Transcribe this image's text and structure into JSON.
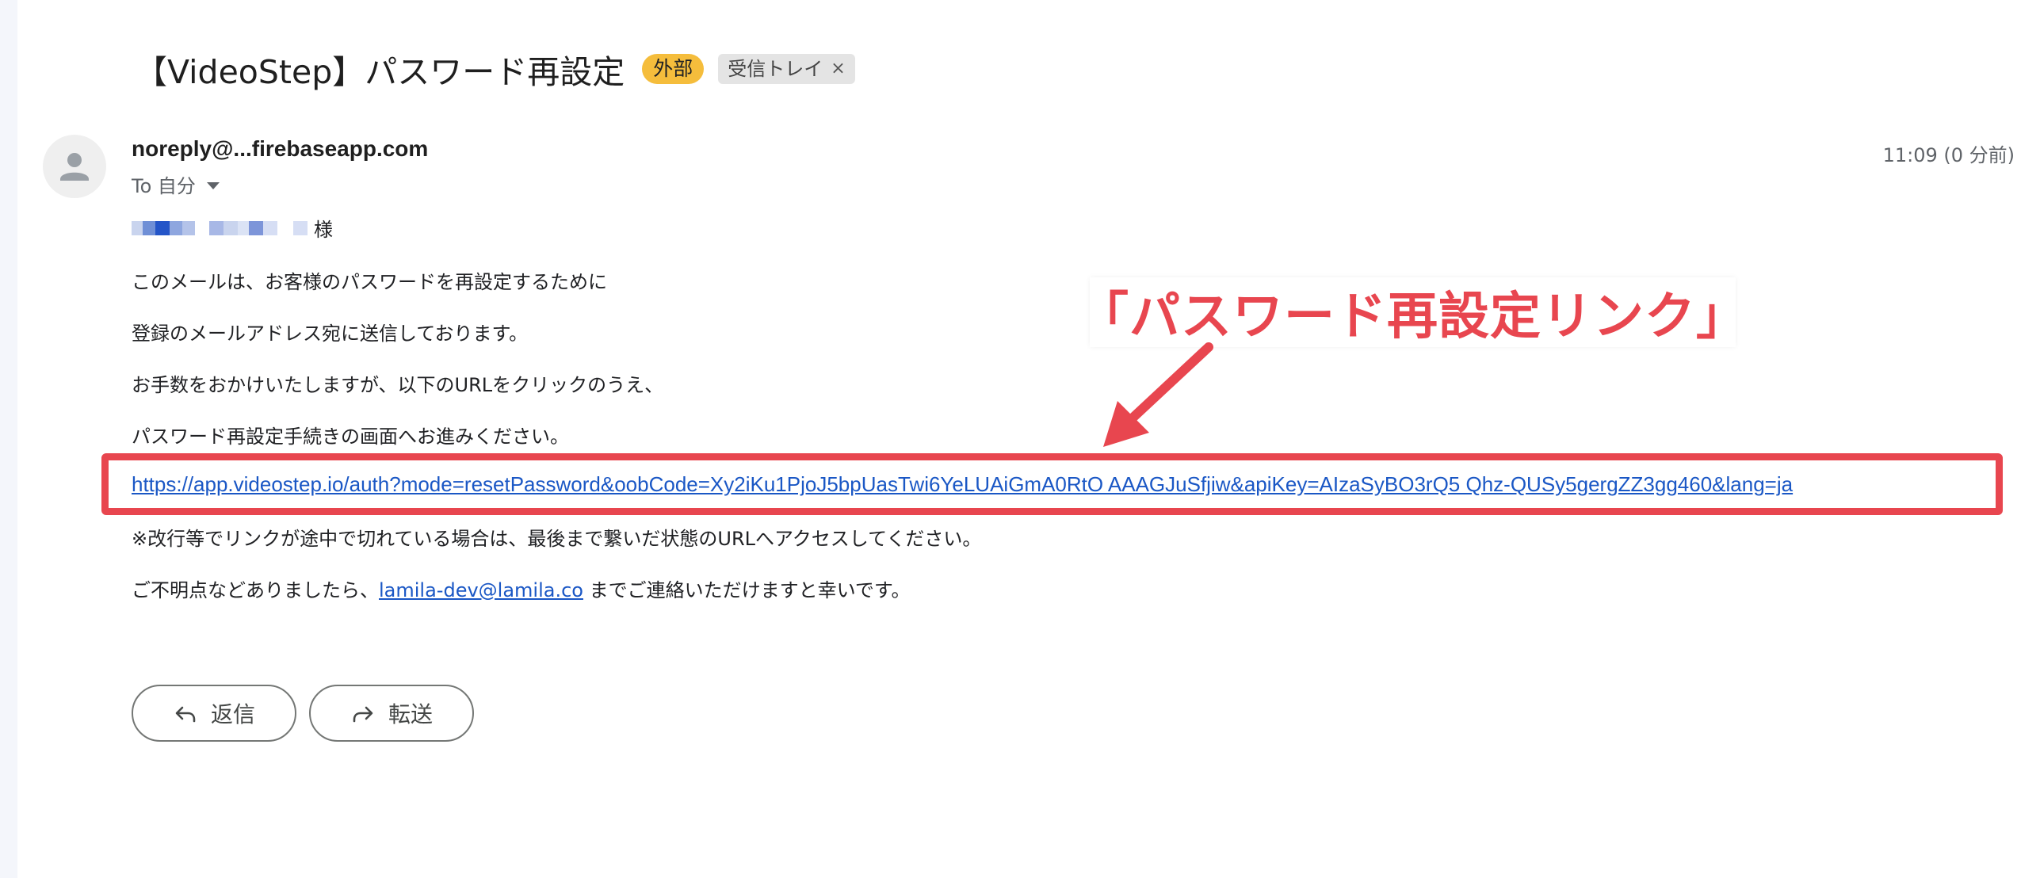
{
  "subject": {
    "title": "【VideoStep】パスワード再設定",
    "external_label": "外部",
    "inbox_label": "受信トレイ",
    "close_glyph": "×"
  },
  "message": {
    "sender": "noreply@...firebaseapp.com",
    "to_label": "To 自分",
    "time": "11:09 (0 分前)",
    "greeting_suffix": "様",
    "lines": [
      "このメールは、お客様のパスワードを再設定するために",
      "登録のメールアドレス宛に送信しております。",
      "お手数をおかけいたしますが、以下のURLをクリックのうえ、",
      "パスワード再設定手続きの画面へお進みください。"
    ],
    "reset_url": "https://app.videostep.io/auth?mode=resetPassword&oobCode=Xy2iKu1PjoJ5bpUasTwi6YeLUAiGmA0RtO AAAGJuSfjiw&apiKey=AIzaSyBO3rQ5 Qhz-QUSy5gergZZ3gg460&lang=ja",
    "note": "※改行等でリンクが途中で切れている場合は、最後まで繋いだ状態のURLへアクセスしてください。",
    "contact_prefix": "ご不明点などありましたら、",
    "contact_email": "lamila-dev@lamila.co",
    "contact_suffix": " までご連絡いただけますと幸いです。"
  },
  "annotation": {
    "callout": "「パスワード再設定リンク」",
    "accent_color": "#e8464f"
  },
  "actions": {
    "reply_label": "返信",
    "forward_label": "転送"
  },
  "colors": {
    "link": "#1a57c5",
    "external_chip": "#f5bd3c",
    "inbox_chip": "#e4e4e4"
  }
}
